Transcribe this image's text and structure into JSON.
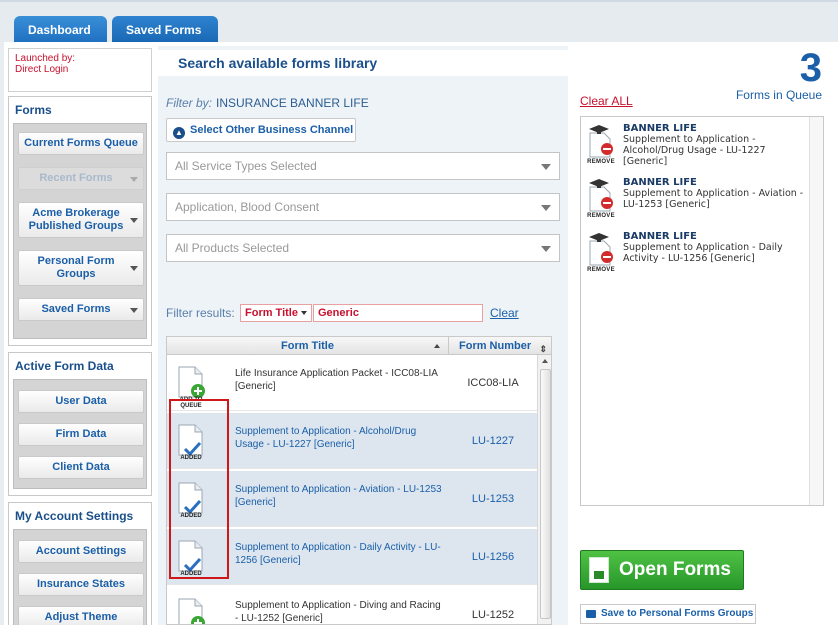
{
  "tabs": [
    {
      "label": "Dashboard"
    },
    {
      "label": "Saved Forms"
    }
  ],
  "sidebar": {
    "launched_by": "Launched by:",
    "launched_value": "Direct Login",
    "forms": {
      "title": "Forms",
      "items": [
        {
          "label": "Current Forms Queue"
        },
        {
          "label": "Recent Forms"
        },
        {
          "label": "Acme Brokerage Published Groups"
        },
        {
          "label": "Personal Form Groups"
        },
        {
          "label": "Saved Forms"
        }
      ]
    },
    "active": {
      "title": "Active Form Data",
      "items": [
        {
          "label": "User Data"
        },
        {
          "label": "Firm Data"
        },
        {
          "label": "Client Data"
        }
      ]
    },
    "account": {
      "title": "My Account Settings",
      "items": [
        {
          "label": "Account Settings"
        },
        {
          "label": "Insurance States"
        },
        {
          "label": "Adjust Theme"
        }
      ]
    }
  },
  "center": {
    "title": "Search available forms library",
    "filter_by_label": "Filter by:",
    "filter_by_value": "INSURANCE   BANNER LIFE",
    "business_btn": "Select Other Business Channel",
    "dropdowns": [
      {
        "value": "All Service Types Selected"
      },
      {
        "value": "Application, Blood Consent"
      },
      {
        "value": "All Products Selected"
      }
    ],
    "filter_results_label": "Filter results:",
    "filter_field": "Form Title",
    "filter_value": "Generic",
    "clear_label": "Clear",
    "table": {
      "col_title": "Form Title",
      "col_number": "Form Number",
      "rows": [
        {
          "badge": "ADD TO QUEUE",
          "title": "Life Insurance Application Packet - ICC08-LIA [Generic]",
          "number": "ICC08-LIA",
          "added": false
        },
        {
          "badge": "ADDED",
          "title": "Supplement to Application - Alcohol/Drug Usage - LU-1227 [Generic]",
          "number": "LU-1227",
          "added": true
        },
        {
          "badge": "ADDED",
          "title": "Supplement to Application - Aviation - LU-1253 [Generic]",
          "number": "LU-1253",
          "added": true
        },
        {
          "badge": "ADDED",
          "title": "Supplement to Application - Daily Activity - LU-1256 [Generic]",
          "number": "LU-1256",
          "added": true
        },
        {
          "badge": "ADD TO QUEUE",
          "title": "Supplement to Application - Diving and Racing - LU-1252 [Generic]",
          "number": "LU-1252",
          "added": false
        }
      ]
    }
  },
  "queue": {
    "count": "3",
    "label": "Forms in Queue",
    "clear_all": "Clear ALL",
    "remove_label": "REMOVE",
    "items": [
      {
        "company": "BANNER LIFE",
        "text": "Supplement to Application - Alcohol/Drug Usage - LU-1227 [Generic]"
      },
      {
        "company": "BANNER LIFE",
        "text": "Supplement to Application - Aviation - LU-1253 [Generic]"
      },
      {
        "company": "BANNER LIFE",
        "text": "Supplement to Application - Daily Activity - LU-1256 [Generic]"
      }
    ],
    "open_btn": "Open Forms",
    "save_btn": "Save to Personal Forms Groups"
  },
  "colors": {
    "accent": "#1a5fa8",
    "alert": "#c8102e",
    "go": "#27962a"
  }
}
